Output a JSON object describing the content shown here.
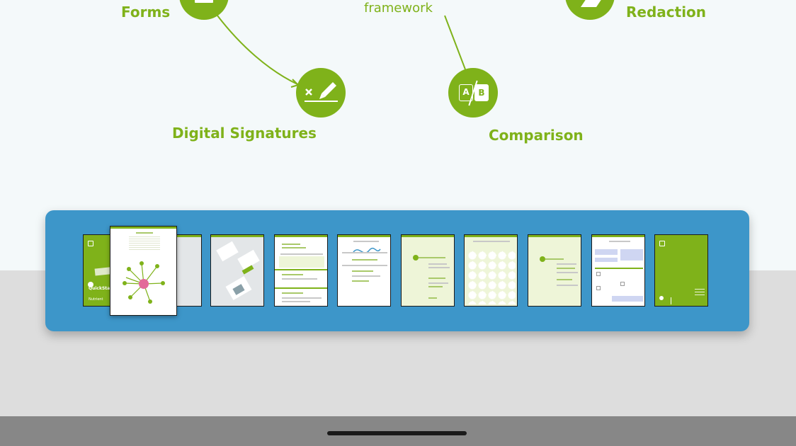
{
  "document": {
    "features": [
      {
        "label": "Forms"
      },
      {
        "label": "Redaction"
      },
      {
        "label": "Digital Signatures"
      },
      {
        "label": "Comparison"
      }
    ],
    "framework_text": "framework",
    "comparison_icon": {
      "left": "A",
      "right": "B"
    },
    "signature_icon": {
      "mark": "×"
    }
  },
  "thumbnails": {
    "count": 11,
    "selected_page": 2,
    "cover_text": {
      "title": "QuickStart Guide",
      "brand": "Nutrient"
    },
    "accent_color": "#7fb21a",
    "strip_color": "#3d96c9"
  }
}
